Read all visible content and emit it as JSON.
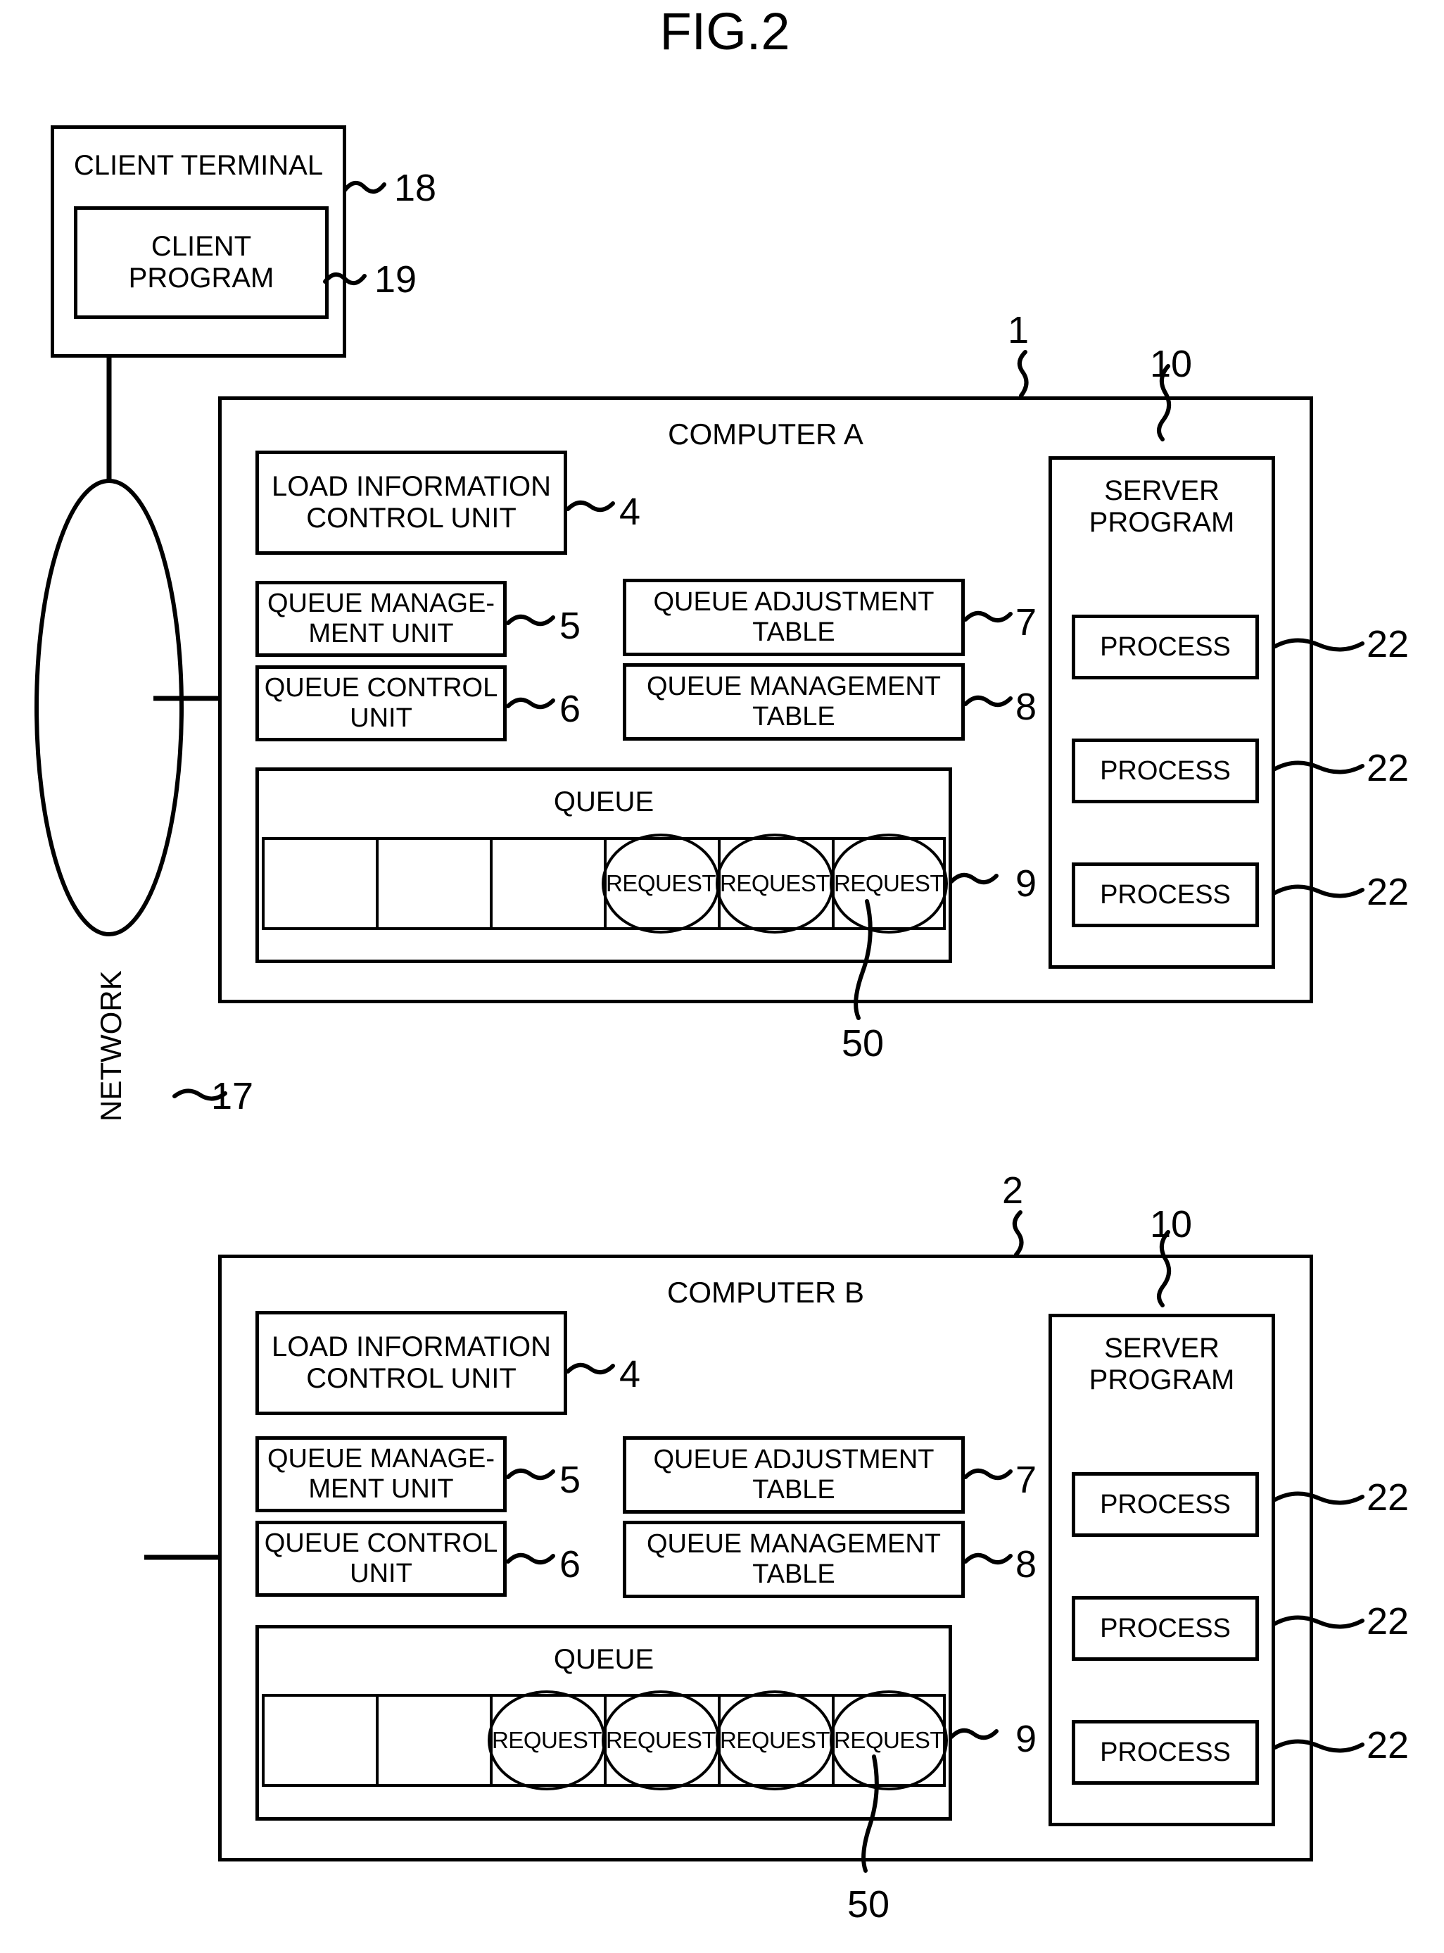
{
  "figure": {
    "title": "FIG.2"
  },
  "client_terminal": {
    "label": "CLIENT TERMINAL",
    "ref": "18",
    "client_program": {
      "label": "CLIENT PROGRAM",
      "label_line1": "CLIENT",
      "label_line2": "PROGRAM",
      "ref": "19"
    }
  },
  "network": {
    "label": "NETWORK",
    "ref": "17"
  },
  "computers": [
    {
      "name": "COMPUTER A",
      "ref": "1",
      "units": [
        {
          "label_line1": "LOAD INFORMATION",
          "label_line2": "CONTROL UNIT",
          "ref": "4"
        },
        {
          "label_line1": "QUEUE MANAGE-",
          "label_line2": "MENT UNIT",
          "ref": "5"
        },
        {
          "label_line1": "QUEUE CONTROL",
          "label_line2": "UNIT",
          "ref": "6"
        }
      ],
      "tables": [
        {
          "label_line1": "QUEUE ADJUSTMENT",
          "label_line2": "TABLE",
          "ref": "7"
        },
        {
          "label_line1": "QUEUE MANAGEMENT",
          "label_line2": "TABLE",
          "ref": "8"
        }
      ],
      "queue": {
        "label": "QUEUE",
        "ref": "9",
        "request_ref": "50",
        "request_label": "REQUEST",
        "total_cells": 6,
        "empty_cells": 3,
        "filled_cells": 3
      },
      "server_program": {
        "label_line1": "SERVER",
        "label_line2": "PROGRAM",
        "ref": "10",
        "processes": [
          {
            "label": "PROCESS",
            "ref": "22"
          },
          {
            "label": "PROCESS",
            "ref": "22"
          },
          {
            "label": "PROCESS",
            "ref": "22"
          }
        ]
      }
    },
    {
      "name": "COMPUTER B",
      "ref": "2",
      "units": [
        {
          "label_line1": "LOAD INFORMATION",
          "label_line2": "CONTROL UNIT",
          "ref": "4"
        },
        {
          "label_line1": "QUEUE MANAGE-",
          "label_line2": "MENT UNIT",
          "ref": "5"
        },
        {
          "label_line1": "QUEUE CONTROL",
          "label_line2": "UNIT",
          "ref": "6"
        }
      ],
      "tables": [
        {
          "label_line1": "QUEUE ADJUSTMENT",
          "label_line2": "TABLE",
          "ref": "7"
        },
        {
          "label_line1": "QUEUE MANAGEMENT",
          "label_line2": "TABLE",
          "ref": "8"
        }
      ],
      "queue": {
        "label": "QUEUE",
        "ref": "9",
        "request_ref": "50",
        "request_label": "REQUEST",
        "total_cells": 6,
        "empty_cells": 2,
        "filled_cells": 4
      },
      "server_program": {
        "label_line1": "SERVER",
        "label_line2": "PROGRAM",
        "ref": "10",
        "processes": [
          {
            "label": "PROCESS",
            "ref": "22"
          },
          {
            "label": "PROCESS",
            "ref": "22"
          },
          {
            "label": "PROCESS",
            "ref": "22"
          }
        ]
      }
    }
  ],
  "colors": {
    "ink": "#000000",
    "paper": "#ffffff"
  }
}
